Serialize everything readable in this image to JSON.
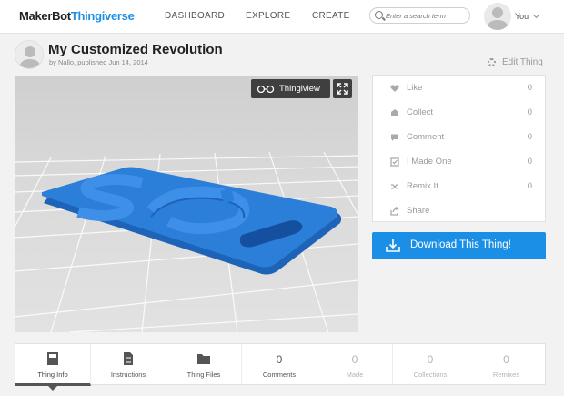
{
  "nav": {
    "logo_maker": "MakerBot",
    "logo_thing": "Thingiverse",
    "links": [
      "DASHBOARD",
      "EXPLORE",
      "CREATE"
    ],
    "search_placeholder": "Enter a search term",
    "user_label": "You"
  },
  "thing": {
    "title": "My Customized Revolution",
    "byline": "by Nallo, published Jun 14, 2014",
    "edit_label": "Edit Thing"
  },
  "viewer": {
    "thingiview_label": "Thingiview",
    "model_color": "#2b7fd8"
  },
  "stats": [
    {
      "label": "Like",
      "count": "0",
      "icon": "heart-icon"
    },
    {
      "label": "Collect",
      "count": "0",
      "icon": "collect-icon"
    },
    {
      "label": "Comment",
      "count": "0",
      "icon": "comment-icon"
    },
    {
      "label": "I Made One",
      "count": "0",
      "icon": "made-icon"
    },
    {
      "label": "Remix It",
      "count": "0",
      "icon": "remix-icon"
    },
    {
      "label": "Share",
      "count": "",
      "icon": "share-icon"
    }
  ],
  "download_label": "Download This Thing!",
  "tabs": [
    {
      "label": "Thing Info",
      "icon": "info-book-icon"
    },
    {
      "label": "Instructions",
      "icon": "document-icon"
    },
    {
      "label": "Thing Files",
      "icon": "folder-icon"
    },
    {
      "label": "Comments",
      "count": "0"
    },
    {
      "label": "Made",
      "count": "0"
    },
    {
      "label": "Collections",
      "count": "0"
    },
    {
      "label": "Remixes",
      "count": "0"
    }
  ],
  "colors": {
    "accent": "#1b8fe6",
    "dark_button": "#3f3f3f"
  }
}
